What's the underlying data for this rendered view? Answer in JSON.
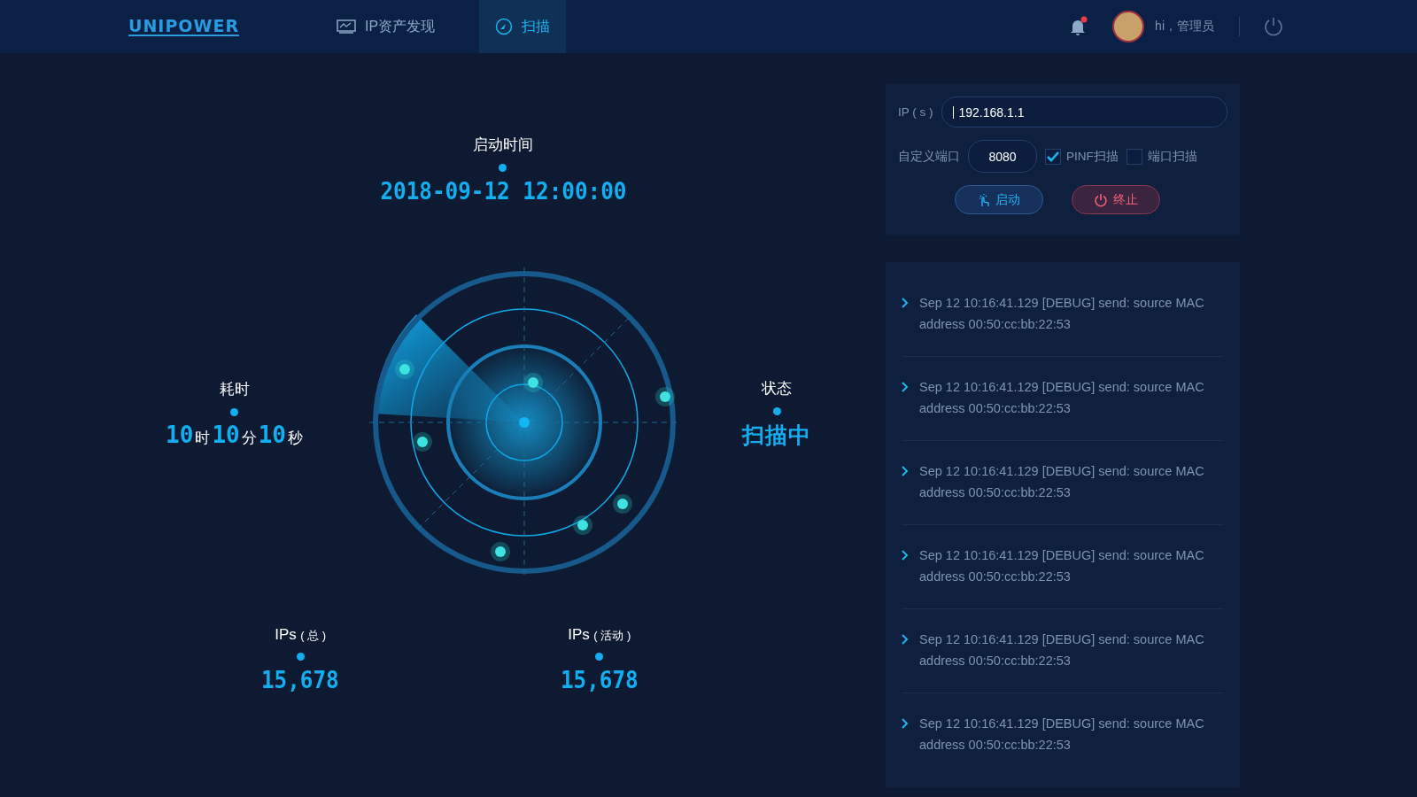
{
  "header": {
    "logo": "UNIPOWER",
    "nav": [
      {
        "label": "IP资产发现",
        "selected": false,
        "kind": "assets"
      },
      {
        "label": "扫描",
        "selected": true,
        "kind": "scan"
      }
    ],
    "notification": {
      "unread": true
    },
    "user": {
      "greeting": "hi，管理员"
    }
  },
  "stats": {
    "start": {
      "label": "启动时间",
      "value": "2018-09-12 12:00:00"
    },
    "elapsed": {
      "label": "耗时",
      "parts": [
        {
          "number": "10",
          "unit": "时"
        },
        {
          "number": "10",
          "unit": "分"
        },
        {
          "number": "10",
          "unit": "秒"
        }
      ]
    },
    "status": {
      "label": "状态",
      "value": "扫描中"
    },
    "ips": [
      {
        "label": "IPs",
        "sub": "( 总 )",
        "value": "15,678"
      },
      {
        "label": "IPs",
        "sub": "( 活动 )",
        "value": "15,678"
      }
    ]
  },
  "form": {
    "ip_label": "IP ( s )",
    "ip_value": "192.168.1.1",
    "port_label": "自定义端口",
    "port_value": "8080",
    "checkboxes": [
      {
        "label": "PINF扫描",
        "checked": true
      },
      {
        "label": "端口扫描",
        "checked": false
      }
    ],
    "buttons": [
      {
        "label": "启动",
        "kind": "start"
      },
      {
        "label": "终止",
        "kind": "stop"
      }
    ]
  },
  "logs": [
    {
      "text": "Sep 12 10:16:41.129 [DEBUG] send: source MAC address 00:50:cc:bb:22:53"
    },
    {
      "text": "Sep 12 10:16:41.129 [DEBUG] send: source MAC address 00:50:cc:bb:22:53"
    },
    {
      "text": "Sep 12 10:16:41.129 [DEBUG] send: source MAC address 00:50:cc:bb:22:53"
    },
    {
      "text": "Sep 12 10:16:41.129 [DEBUG] send: source MAC address 00:50:cc:bb:22:53"
    },
    {
      "text": "Sep 12 10:16:41.129 [DEBUG] send: source MAC address 00:50:cc:bb:22:53"
    },
    {
      "text": "Sep 12 10:16:41.129 [DEBUG] send: source MAC address 00:50:cc:bb:22:53"
    }
  ]
}
